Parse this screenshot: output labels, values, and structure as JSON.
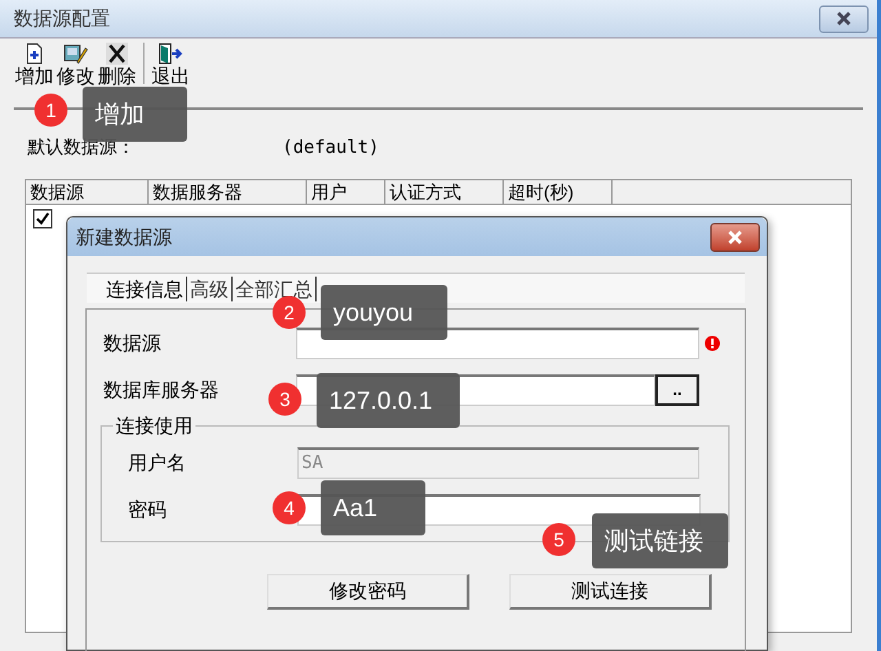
{
  "window": {
    "title": "数据源配置"
  },
  "toolbar": [
    {
      "label": "增加",
      "kind": "add"
    },
    {
      "label": "修改",
      "kind": "edit"
    },
    {
      "label": "删除",
      "kind": "delete"
    },
    {
      "label": "退出",
      "kind": "exit"
    }
  ],
  "default_source": {
    "label": "默认数据源：",
    "value": "(default)"
  },
  "table": {
    "columns": [
      "数据源",
      "数据服务器",
      "用户",
      "认证方式",
      "超时(秒)"
    ],
    "rows": [
      {
        "checked": true
      }
    ]
  },
  "dialog": {
    "title": "新建数据源",
    "tabs": [
      {
        "label": "连接信息",
        "selected": true
      },
      {
        "label": "高级",
        "selected": false
      },
      {
        "label": "全部汇总",
        "selected": false
      }
    ],
    "fields": [
      {
        "label": "数据源",
        "error": true
      },
      {
        "label": "数据库服务器",
        "browse": ".."
      }
    ],
    "group": {
      "title": "连接使用",
      "fields": [
        {
          "label": "用户名",
          "value": "SA",
          "disabled": true
        },
        {
          "label": "密码",
          "disabled": false
        }
      ]
    },
    "buttons": [
      "修改密码",
      "测试连接"
    ]
  },
  "callouts": [
    {
      "number": "1",
      "text": "增加"
    },
    {
      "number": "2",
      "text": "youyou"
    },
    {
      "number": "3",
      "text": "127.0.0.1"
    },
    {
      "number": "4",
      "text": "Aa1"
    },
    {
      "number": "5",
      "text": "测试链接"
    }
  ]
}
